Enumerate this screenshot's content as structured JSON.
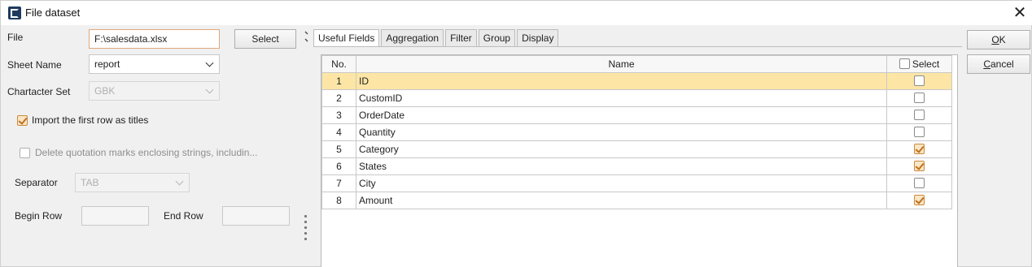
{
  "window": {
    "title": "File dataset",
    "close_glyph": "✕"
  },
  "form": {
    "file_label": "File",
    "file_value": "F:\\salesdata.xlsx",
    "select_button": "Select",
    "sheet_label": "Sheet Name",
    "sheet_value": "report",
    "charset_label": "Chartacter Set",
    "charset_value": "GBK",
    "import_titles_label": "Import the first row as titles",
    "import_titles_checked": true,
    "delete_quotes_label": "Delete quotation marks enclosing strings, includin...",
    "delete_quotes_checked": false,
    "separator_label": "Separator",
    "separator_value": "TAB",
    "begin_row_label": "Begin Row",
    "begin_row_value": "",
    "end_row_label": "End Row",
    "end_row_value": ""
  },
  "tabs": [
    {
      "label": "Useful Fields",
      "selected": true
    },
    {
      "label": "Aggregation",
      "selected": false
    },
    {
      "label": "Filter",
      "selected": false
    },
    {
      "label": "Group",
      "selected": false
    },
    {
      "label": "Display",
      "selected": false
    }
  ],
  "table": {
    "headers": {
      "no": "No.",
      "name": "Name",
      "select": "Select"
    },
    "rows": [
      {
        "no": "1",
        "name": "ID",
        "selected": false,
        "highlighted": true
      },
      {
        "no": "2",
        "name": "CustomID",
        "selected": false,
        "highlighted": false
      },
      {
        "no": "3",
        "name": "OrderDate",
        "selected": false,
        "highlighted": false
      },
      {
        "no": "4",
        "name": "Quantity",
        "selected": false,
        "highlighted": false
      },
      {
        "no": "5",
        "name": "Category",
        "selected": true,
        "highlighted": false
      },
      {
        "no": "6",
        "name": "States",
        "selected": true,
        "highlighted": false
      },
      {
        "no": "7",
        "name": "City",
        "selected": false,
        "highlighted": false
      },
      {
        "no": "8",
        "name": "Amount",
        "selected": true,
        "highlighted": false
      }
    ]
  },
  "actions": {
    "ok_mnemonic": "O",
    "ok_rest": "K",
    "cancel_mnemonic": "C",
    "cancel_rest": "ancel"
  },
  "colors": {
    "row_highlight": "#fde6a5",
    "accent_check": "#c0711f"
  }
}
